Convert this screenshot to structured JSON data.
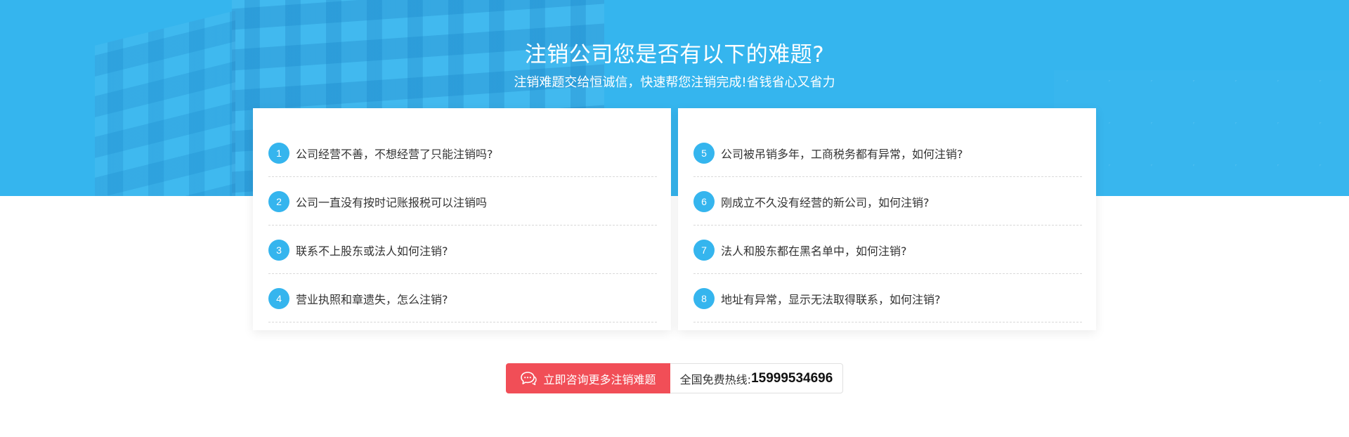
{
  "hero": {
    "title": "注销公司您是否有以下的难题?",
    "subtitle": "注销难题交给恒诚信，快速帮您注销完成!省钱省心又省力",
    "background_color": "#35b5ee"
  },
  "questions_left": [
    {
      "num": "1",
      "text": "公司经营不善，不想经营了只能注销吗?"
    },
    {
      "num": "2",
      "text": "公司一直没有按时记账报税可以注销吗"
    },
    {
      "num": "3",
      "text": "联系不上股东或法人如何注销?"
    },
    {
      "num": "4",
      "text": "营业执照和章遗失，怎么注销?"
    }
  ],
  "questions_right": [
    {
      "num": "5",
      "text": "公司被吊销多年，工商税务都有异常，如何注销?"
    },
    {
      "num": "6",
      "text": "刚成立不久没有经营的新公司，如何注销?"
    },
    {
      "num": "7",
      "text": "法人和股东都在黑名单中，如何注销?"
    },
    {
      "num": "8",
      "text": "地址有异常，显示无法取得联系，如何注销?"
    }
  ],
  "cta": {
    "button_label": "立即咨询更多注销难题",
    "button_icon": "chat-bubble-icon",
    "hotline_label": "全国免费热线:",
    "hotline_number": "15999534696",
    "button_color": "#f14e57",
    "accent_color": "#35b5ee"
  }
}
